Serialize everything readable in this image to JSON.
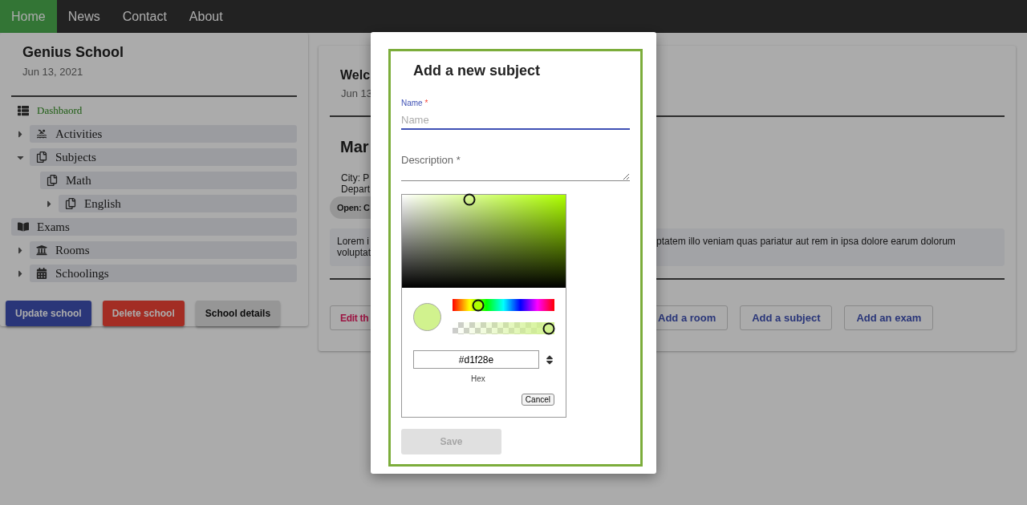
{
  "nav": {
    "items": [
      {
        "label": "Home",
        "selected": true
      },
      {
        "label": "News",
        "selected": false
      },
      {
        "label": "Contact",
        "selected": false
      },
      {
        "label": "About",
        "selected": false
      }
    ]
  },
  "sidebar": {
    "title": "Genius School",
    "date": "Jun 13, 2021",
    "tree": [
      {
        "label": "Dashbaord",
        "kind": "leaf",
        "selected": true
      },
      {
        "label": "Activities",
        "kind": "branch",
        "expanded": false,
        "selected": false
      },
      {
        "label": "Subjects",
        "kind": "branch",
        "expanded": true,
        "selected": false,
        "children": [
          {
            "label": "Math",
            "kind": "leaf",
            "selected": false
          },
          {
            "label": "English",
            "kind": "branch",
            "expanded": false,
            "selected": false
          }
        ]
      },
      {
        "label": "Exams",
        "kind": "leaf",
        "selected": false
      },
      {
        "label": "Rooms",
        "kind": "branch",
        "expanded": false,
        "selected": false
      },
      {
        "label": "Schoolings",
        "kind": "branch",
        "expanded": false,
        "selected": false
      }
    ],
    "buttons": [
      {
        "label": "Update school",
        "kind": "primary"
      },
      {
        "label": "Delete school",
        "kind": "danger"
      },
      {
        "label": "School details",
        "kind": "plain"
      }
    ]
  },
  "main": {
    "title": "Welc",
    "date": "Jun 13",
    "heading": "Mar",
    "info": [
      "City: P",
      "Depart"
    ],
    "chip": "Open: C",
    "description": {
      "left_lines": [
        "Lorem i",
        "voluptat"
      ],
      "right": "ptatem illo veniam quas pariatur aut rem in ipsa dolore earum dolorum"
    },
    "buttons": [
      {
        "label": "Edit th",
        "kind": "secondary"
      },
      {
        "label": "Add a room",
        "kind": "primary"
      },
      {
        "label": "Add a subject",
        "kind": "primary"
      },
      {
        "label": "Add an exam",
        "kind": "primary"
      }
    ]
  },
  "modal": {
    "title": "Add a new subject",
    "name_field": {
      "label": "Name",
      "required_mark": "*",
      "placeholder": "Name",
      "focused": true
    },
    "description_field": {
      "label": "Description",
      "required_mark": "*",
      "focused": false
    },
    "color_picker": {
      "saturation": {
        "level": 0.41
      },
      "hue": {
        "level": 0.22
      },
      "alpha": {
        "level": 1
      },
      "hex": "#d1f28e",
      "hex_label": "Hex",
      "cancel": "Cancel"
    },
    "save": {
      "label": "Save",
      "disabled": true
    }
  }
}
